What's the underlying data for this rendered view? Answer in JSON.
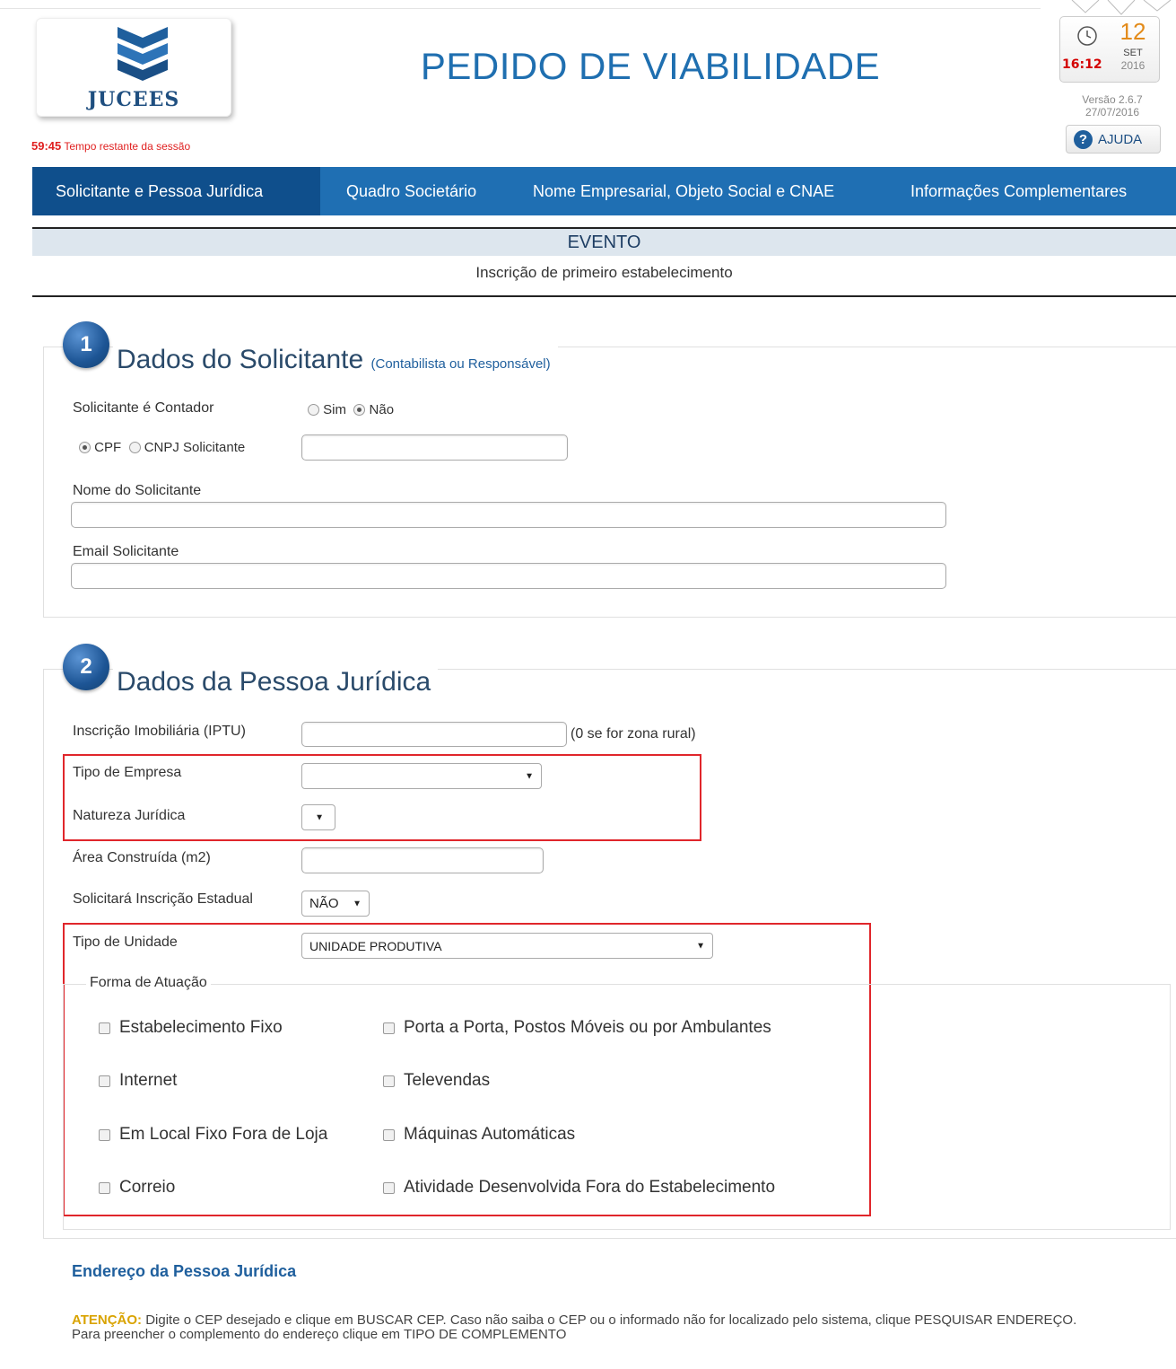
{
  "header": {
    "logo_text": "JUCEES",
    "title": "PEDIDO DE VIABILIDADE",
    "session_time": "59:45",
    "session_label": "Tempo restante da sessão",
    "clock_time": "16:12",
    "clock_day": "12",
    "clock_month": "SET",
    "clock_year": "2016",
    "version": "Versão 2.6.7",
    "version_date": "27/07/2016",
    "help_label": "AJUDA"
  },
  "nav": {
    "tabs": [
      {
        "label": "Solicitante e Pessoa Jurídica",
        "active": true
      },
      {
        "label": "Quadro Societário",
        "active": false
      },
      {
        "label": "Nome Empresarial, Objeto Social e CNAE",
        "active": false
      },
      {
        "label": "Informações Complementares",
        "active": false
      }
    ]
  },
  "evento": {
    "title": "EVENTO",
    "value": "Inscrição de primeiro estabelecimento"
  },
  "section1": {
    "number": "1",
    "title": "Dados do Solicitante",
    "subtitle": "(Contabilista ou Responsável)",
    "contador_label": "Solicitante é Contador",
    "opt_sim": "Sim",
    "opt_nao": "Não",
    "opt_cpf": "CPF",
    "opt_cnpj": "CNPJ Solicitante",
    "nome_label": "Nome do Solicitante",
    "email_label": "Email Solicitante",
    "cpf_value": "",
    "nome_value": "",
    "email_value": ""
  },
  "section2": {
    "number": "2",
    "title": "Dados da Pessoa Jurídica",
    "iptu_label": "Inscrição Imobiliária (IPTU)",
    "iptu_hint": "(0 se for zona rural)",
    "iptu_value": "",
    "tipo_empresa_label": "Tipo de Empresa",
    "tipo_empresa_value": "",
    "natureza_label": "Natureza Jurídica",
    "natureza_value": "",
    "area_label": "Área Construída (m2)",
    "area_value": "",
    "ie_label": "Solicitará Inscrição Estadual",
    "ie_value": "NÃO",
    "tipo_unidade_label": "Tipo de Unidade",
    "tipo_unidade_value": "UNIDADE PRODUTIVA",
    "forma_label": "Forma de Atuação",
    "forma_options_left": [
      "Estabelecimento Fixo",
      "Internet",
      "Em Local Fixo Fora de Loja",
      "Correio"
    ],
    "forma_options_right": [
      "Porta a Porta, Postos Móveis ou por Ambulantes",
      "Televendas",
      "Máquinas Automáticas",
      "Atividade Desenvolvida Fora do Estabelecimento"
    ]
  },
  "endereco": {
    "title": "Endereço da Pessoa Jurídica",
    "attention_label": "ATENÇÃO:",
    "attention_text": " Digite o CEP desejado e clique em BUSCAR CEP. Caso não saiba o CEP ou o informado não for localizado pelo sistema, clique PESQUISAR ENDEREÇO.",
    "complement_text": "Para preencher o complemento do endereço clique em TIPO DE COMPLEMENTO"
  },
  "colors": {
    "nav_bg": "#1f6fb3",
    "nav_active": "#0f4f8c",
    "title_blue": "#1f6fb0",
    "highlight_red": "#e0262b",
    "warning": "#d9a300"
  }
}
